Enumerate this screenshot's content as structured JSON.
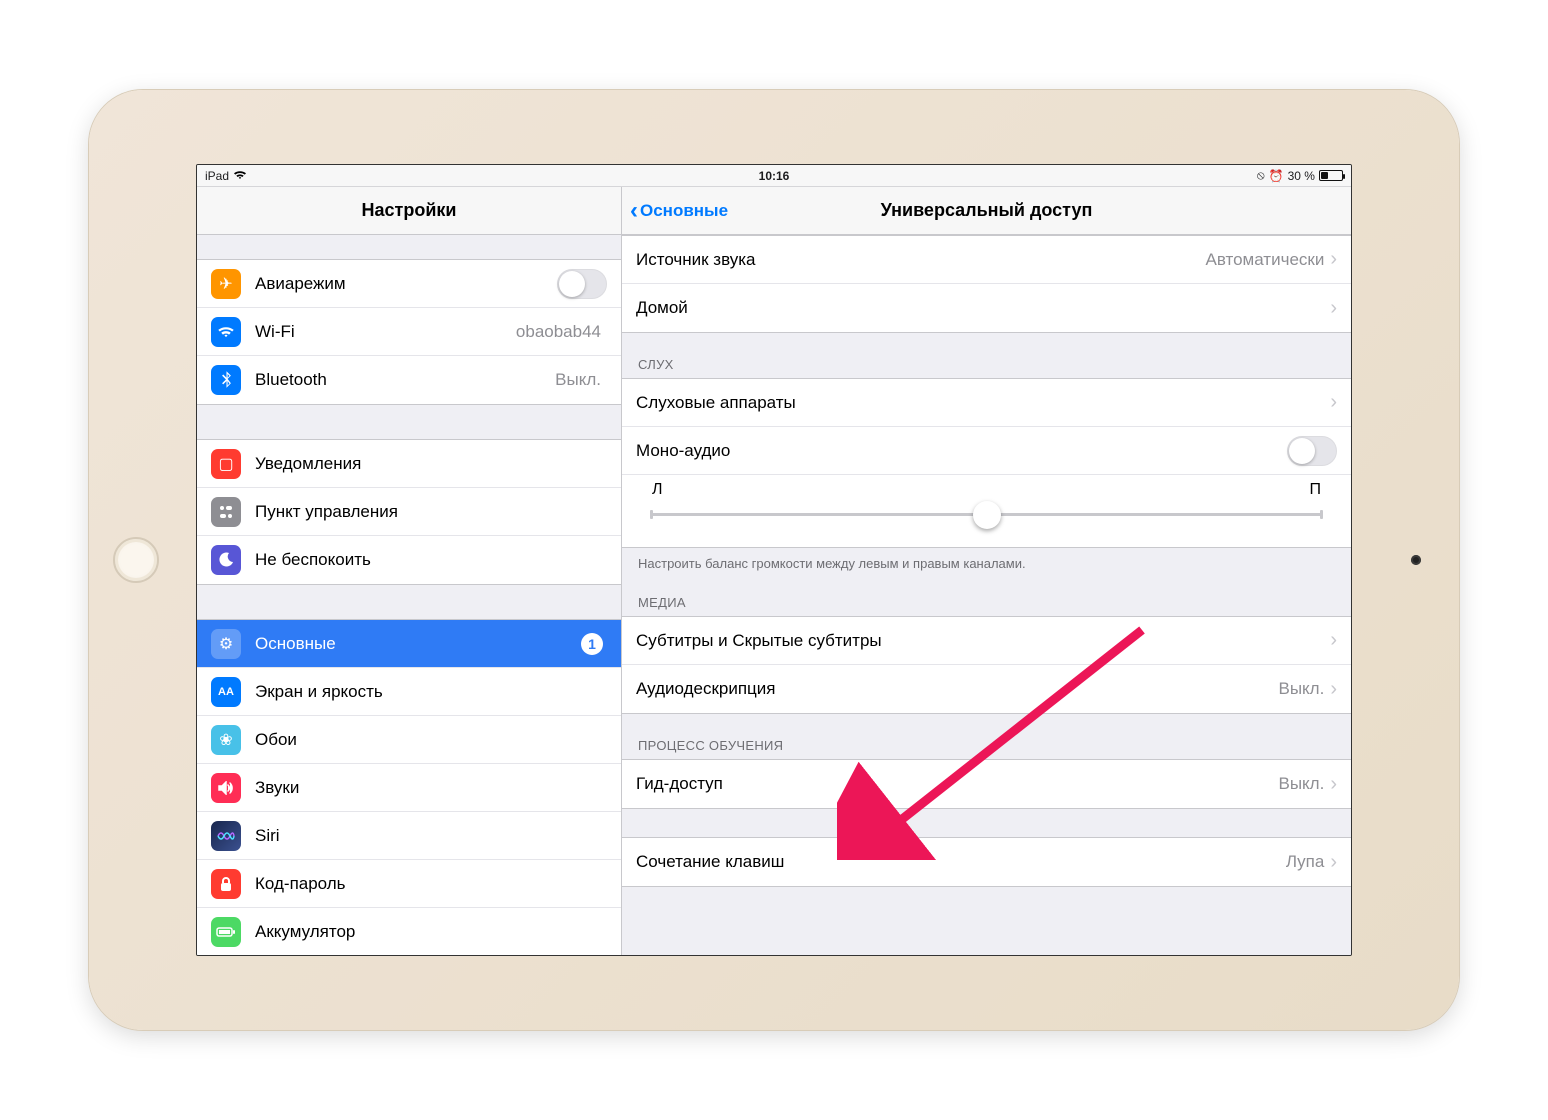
{
  "status_bar": {
    "device": "iPad",
    "time": "10:16",
    "battery_percent": "30 %",
    "battery_level": 0.3
  },
  "sidebar": {
    "title": "Настройки",
    "group1": [
      {
        "id": "airplane",
        "label": "Авиарежим",
        "switch": false
      },
      {
        "id": "wifi",
        "label": "Wi-Fi",
        "value": "obaobab44"
      },
      {
        "id": "bluetooth",
        "label": "Bluetooth",
        "value": "Выкл."
      }
    ],
    "group2": [
      {
        "id": "notifications",
        "label": "Уведомления"
      },
      {
        "id": "control-center",
        "label": "Пункт управления"
      },
      {
        "id": "dnd",
        "label": "Не беспокоить"
      }
    ],
    "group3": [
      {
        "id": "general",
        "label": "Основные",
        "badge": "1",
        "selected": true
      },
      {
        "id": "display",
        "label": "Экран и яркость"
      },
      {
        "id": "wallpaper",
        "label": "Обои"
      },
      {
        "id": "sounds",
        "label": "Звуки"
      },
      {
        "id": "siri",
        "label": "Siri"
      },
      {
        "id": "passcode",
        "label": "Код-пароль"
      },
      {
        "id": "battery",
        "label": "Аккумулятор"
      }
    ]
  },
  "detail": {
    "back_label": "Основные",
    "title": "Универсальный доступ",
    "top_group": [
      {
        "id": "audio-source",
        "label": "Источник звука",
        "value": "Автоматически",
        "chevron": true
      },
      {
        "id": "home",
        "label": "Домой",
        "chevron": true
      }
    ],
    "hearing_header": "СЛУХ",
    "hearing_group": {
      "hearing_devices": {
        "label": "Слуховые аппараты",
        "chevron": true
      },
      "mono_audio": {
        "label": "Моно-аудио",
        "switch": false
      },
      "balance": {
        "left": "Л",
        "right": "П",
        "value": 0.5
      }
    },
    "hearing_footer": "Настроить баланс громкости между левым и правым каналами.",
    "media_header": "МЕДИА",
    "media_group": [
      {
        "id": "subtitles",
        "label": "Субтитры и Скрытые субтитры",
        "chevron": true
      },
      {
        "id": "audio-desc",
        "label": "Аудиодескрипция",
        "value": "Выкл.",
        "chevron": true
      }
    ],
    "learning_header": "ПРОЦЕСС ОБУЧЕНИЯ",
    "learning_group": [
      {
        "id": "guided-access",
        "label": "Гид-доступ",
        "value": "Выкл.",
        "chevron": true
      }
    ],
    "shortcut_group": [
      {
        "id": "shortcut",
        "label": "Сочетание клавиш",
        "value": "Лупа",
        "chevron": true
      }
    ]
  },
  "colors": {
    "selected_row": "#2f7bf5",
    "link_blue": "#007aff",
    "annotation_arrow": "#ec1657"
  }
}
